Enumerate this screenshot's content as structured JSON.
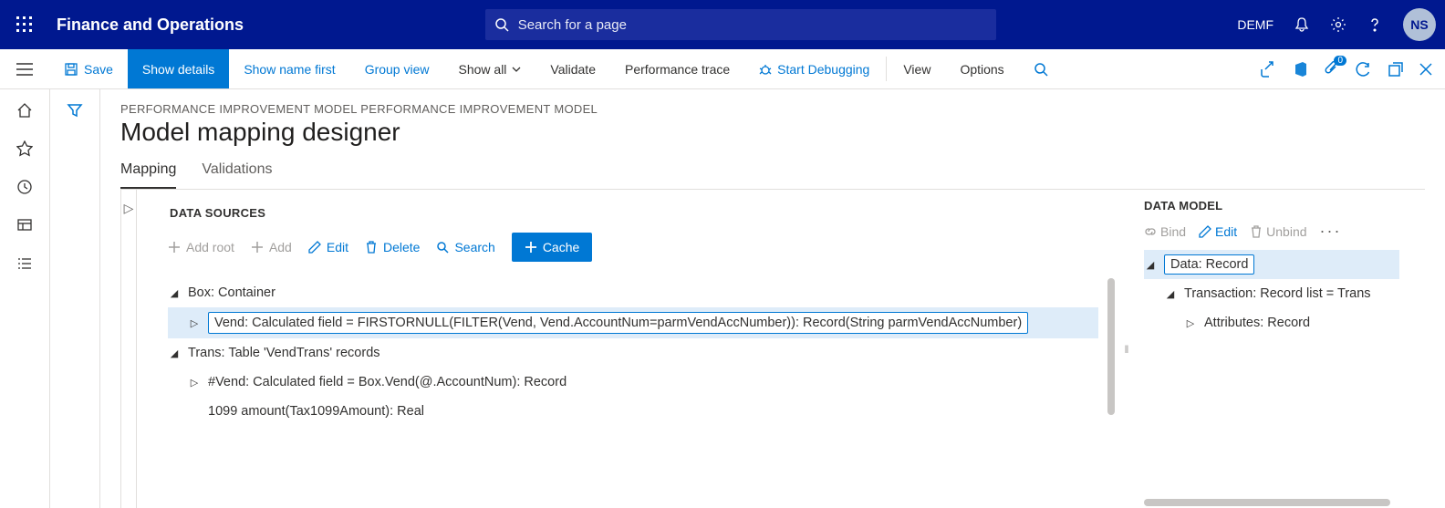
{
  "topbar": {
    "app_title": "Finance and Operations",
    "search_placeholder": "Search for a page",
    "legal_entity": "DEMF",
    "user_initials": "NS"
  },
  "ribbon": {
    "save": "Save",
    "show_details": "Show details",
    "show_name_first": "Show name first",
    "group_view": "Group view",
    "show_all": "Show all",
    "validate": "Validate",
    "performance_trace": "Performance trace",
    "start_debugging": "Start Debugging",
    "view": "View",
    "options": "Options"
  },
  "breadcrumb": "PERFORMANCE IMPROVEMENT MODEL PERFORMANCE IMPROVEMENT MODEL",
  "page_title": "Model mapping designer",
  "tabs": {
    "mapping": "Mapping",
    "validations": "Validations"
  },
  "data_sources": {
    "heading": "DATA SOURCES",
    "toolbar": {
      "add_root": "Add root",
      "add": "Add",
      "edit": "Edit",
      "delete": "Delete",
      "search": "Search",
      "cache": "Cache"
    },
    "tree": [
      {
        "level": 0,
        "expanded": true,
        "selected": false,
        "text": "Box: Container"
      },
      {
        "level": 1,
        "expanded": false,
        "selected": true,
        "text": "Vend: Calculated field = FIRSTORNULL(FILTER(Vend, Vend.AccountNum=parmVendAccNumber)): Record(String parmVendAccNumber)"
      },
      {
        "level": 0,
        "expanded": true,
        "selected": false,
        "text": "Trans: Table 'VendTrans' records"
      },
      {
        "level": 1,
        "expanded": false,
        "selected": false,
        "text": "#Vend: Calculated field = Box.Vend(@.AccountNum): Record"
      },
      {
        "level": 1,
        "expanded": null,
        "selected": false,
        "text": "1099 amount(Tax1099Amount): Real"
      }
    ]
  },
  "data_model": {
    "heading": "DATA MODEL",
    "toolbar": {
      "bind": "Bind",
      "edit": "Edit",
      "unbind": "Unbind"
    },
    "tree": [
      {
        "level": 0,
        "expanded": true,
        "selected": true,
        "text": "Data: Record"
      },
      {
        "level": 1,
        "expanded": true,
        "selected": false,
        "text": "Transaction: Record list = Trans"
      },
      {
        "level": 2,
        "expanded": false,
        "selected": false,
        "text": "Attributes: Record"
      }
    ]
  }
}
